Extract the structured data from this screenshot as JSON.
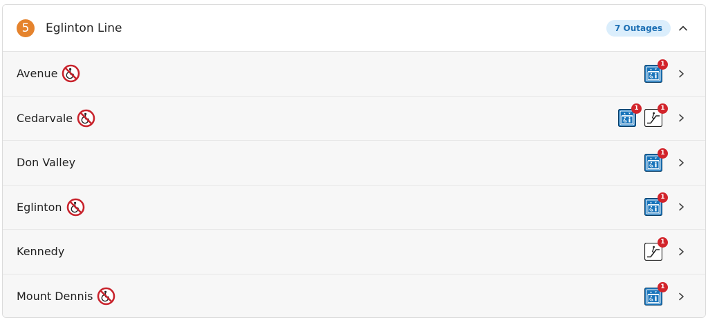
{
  "line": {
    "number": "5",
    "name": "Eglinton Line",
    "outages_label": "7 Outages",
    "accent": "#e5832d"
  },
  "colors": {
    "elevator": "#1a75bb",
    "alert": "#d2242b",
    "no_access": "#c8232c"
  },
  "icons": {
    "inaccessible": "no-wheelchair-icon",
    "elevator": "elevator-icon",
    "escalator": "escalator-icon",
    "expand": "chevron-up-icon",
    "row": "chevron-right-icon"
  },
  "stations": [
    {
      "name": "Avenue",
      "inaccessible": true,
      "outages": [
        {
          "type": "elevator",
          "count": "1"
        }
      ]
    },
    {
      "name": "Cedarvale",
      "inaccessible": true,
      "outages": [
        {
          "type": "elevator",
          "count": "1"
        },
        {
          "type": "escalator",
          "count": "1"
        }
      ]
    },
    {
      "name": "Don Valley",
      "inaccessible": false,
      "outages": [
        {
          "type": "elevator",
          "count": "1"
        }
      ]
    },
    {
      "name": "Eglinton",
      "inaccessible": true,
      "outages": [
        {
          "type": "elevator",
          "count": "1"
        }
      ]
    },
    {
      "name": "Kennedy",
      "inaccessible": false,
      "outages": [
        {
          "type": "escalator",
          "count": "1"
        }
      ]
    },
    {
      "name": "Mount Dennis",
      "inaccessible": true,
      "outages": [
        {
          "type": "elevator",
          "count": "1"
        }
      ]
    }
  ]
}
